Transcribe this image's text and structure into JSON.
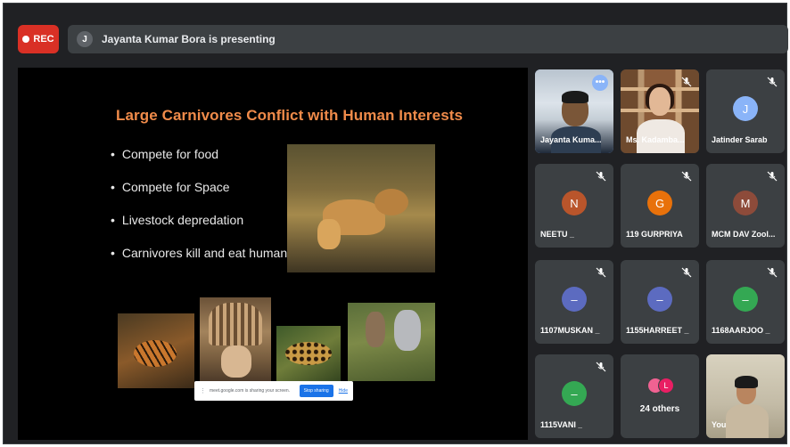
{
  "topbar": {
    "rec_label": "REC",
    "presenter_initial": "J",
    "presenting_text": "Jayanta Kumar Bora is presenting"
  },
  "slide": {
    "title": "Large Carnivores Conflict with Human Interests",
    "bullets": [
      "Compete for food",
      "Compete for Space",
      "Livestock depredation",
      "Carnivores kill and eat humans"
    ]
  },
  "share_bar": {
    "message": "meet.google.com is sharing your screen.",
    "stop_label": "Stop sharing",
    "hide_label": "Hide"
  },
  "participants": [
    {
      "name": "Jayanta Kuma...",
      "type": "video"
    },
    {
      "name": "Ms. Kadamba...",
      "type": "video"
    },
    {
      "name": "Jatinder Sarab",
      "initial": "J",
      "color": "#8ab4f8"
    },
    {
      "name": "NEETU _",
      "initial": "N",
      "color": "#b9552b"
    },
    {
      "name": "119 GURPRIYA",
      "initial": "G",
      "color": "#e8710a"
    },
    {
      "name": "MCM DAV Zool...",
      "initial": "M",
      "color": "#8d4b3a"
    },
    {
      "name": "1107MUSKAN _",
      "initial": "–",
      "color": "#5c6bc0"
    },
    {
      "name": "1155HARREET _",
      "initial": "–",
      "color": "#5c6bc0"
    },
    {
      "name": "1168AARJOO _",
      "initial": "–",
      "color": "#34a853"
    },
    {
      "name": "1115VANI _",
      "initial": "–",
      "color": "#34a853"
    },
    {
      "name": "You",
      "type": "video"
    }
  ],
  "others": {
    "label": "24 others",
    "initial": "L",
    "colors": [
      "#f06292",
      "#e91e63"
    ]
  }
}
